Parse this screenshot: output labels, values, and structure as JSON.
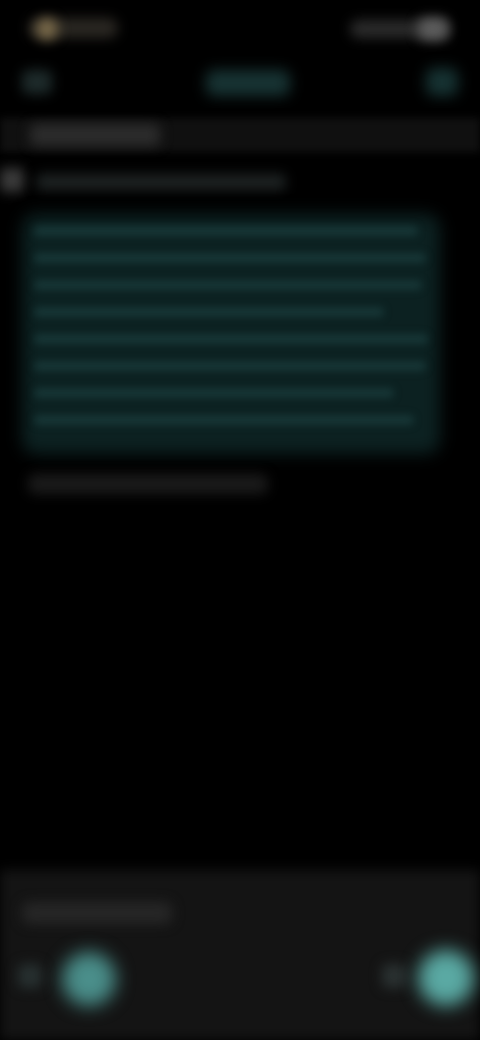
{
  "colors": {
    "background": "#000000",
    "card": "#0c2121",
    "accent": "#5aa9a3",
    "panel": "#141414"
  },
  "status_bar": {
    "clock_icon": "clock-icon",
    "system_icons": "system-status-icons",
    "battery_icon": "battery-icon"
  },
  "toolbar": {
    "back_icon": "back-arrow-icon",
    "action_icon": "toolbar-action-icon"
  },
  "composer": {
    "left_icon": "attachment-icon",
    "left_fab_icon": "record-icon",
    "right_icon": "emoji-icon",
    "right_fab_icon": "send-icon"
  }
}
